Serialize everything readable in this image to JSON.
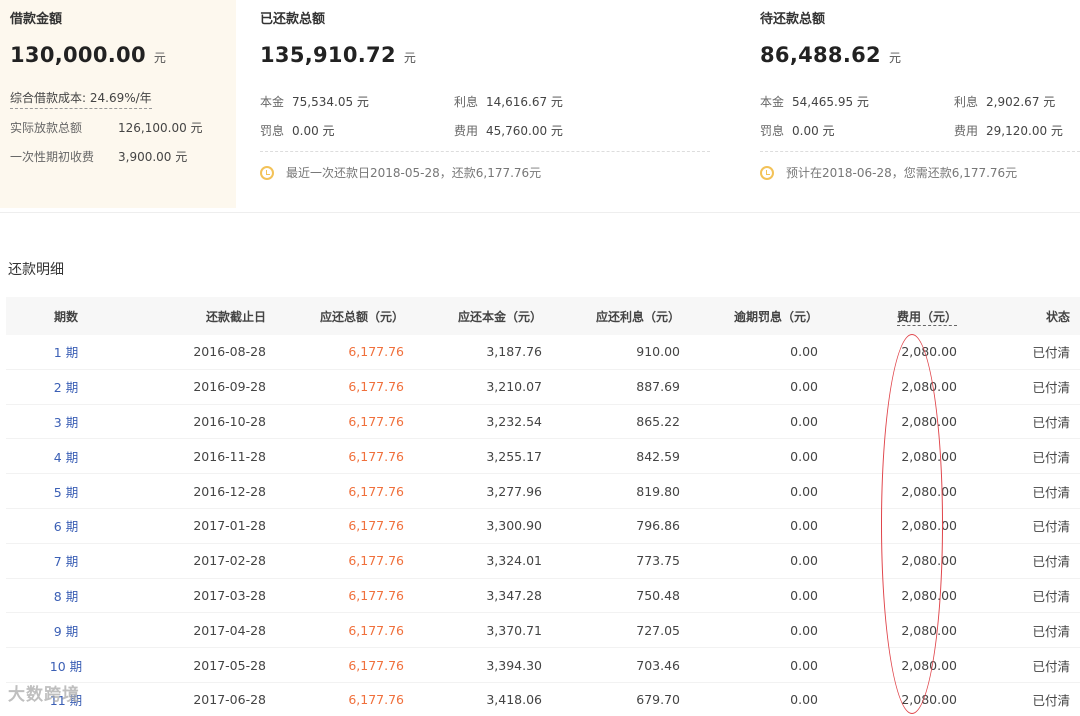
{
  "loan": {
    "title": "借款金額",
    "amount": "130,000.00",
    "unit": "元",
    "cost_rate": "综合借款成本: 24.69%/年",
    "rows": [
      {
        "label": "实际放款总额",
        "value": "126,100.00 元"
      },
      {
        "label": "一次性期初收费",
        "value": "3,900.00 元"
      }
    ]
  },
  "paid": {
    "title": "已还款总额",
    "amount": "135,910.72",
    "unit": "元",
    "items": [
      {
        "label": "本金",
        "value": "75,534.05 元"
      },
      {
        "label": "利息",
        "value": "14,616.67 元"
      },
      {
        "label": "罚息",
        "value": "0.00 元"
      },
      {
        "label": "费用",
        "value": "45,760.00 元"
      }
    ],
    "note": "最近一次还款日2018-05-28，还款6,177.76元"
  },
  "due": {
    "title": "待还款总额",
    "amount": "86,488.62",
    "unit": "元",
    "items": [
      {
        "label": "本金",
        "value": "54,465.95 元"
      },
      {
        "label": "利息",
        "value": "2,902.67 元"
      },
      {
        "label": "罚息",
        "value": "0.00 元"
      },
      {
        "label": "费用",
        "value": "29,120.00 元"
      }
    ],
    "note": "预计在2018-06-28，您需还款6,177.76元"
  },
  "details": {
    "title": "还款明细",
    "headers": [
      "期数",
      "还款截止日",
      "应还总额（元）",
      "应还本金（元）",
      "应还利息（元）",
      "逾期罚息（元）",
      "费用（元）",
      "状态"
    ],
    "rows": [
      [
        "1 期",
        "2016-08-28",
        "6,177.76",
        "3,187.76",
        "910.00",
        "0.00",
        "2,080.00",
        "已付清"
      ],
      [
        "2 期",
        "2016-09-28",
        "6,177.76",
        "3,210.07",
        "887.69",
        "0.00",
        "2,080.00",
        "已付清"
      ],
      [
        "3 期",
        "2016-10-28",
        "6,177.76",
        "3,232.54",
        "865.22",
        "0.00",
        "2,080.00",
        "已付清"
      ],
      [
        "4 期",
        "2016-11-28",
        "6,177.76",
        "3,255.17",
        "842.59",
        "0.00",
        "2,080.00",
        "已付清"
      ],
      [
        "5 期",
        "2016-12-28",
        "6,177.76",
        "3,277.96",
        "819.80",
        "0.00",
        "2,080.00",
        "已付清"
      ],
      [
        "6 期",
        "2017-01-28",
        "6,177.76",
        "3,300.90",
        "796.86",
        "0.00",
        "2,080.00",
        "已付清"
      ],
      [
        "7 期",
        "2017-02-28",
        "6,177.76",
        "3,324.01",
        "773.75",
        "0.00",
        "2,080.00",
        "已付清"
      ],
      [
        "8 期",
        "2017-03-28",
        "6,177.76",
        "3,347.28",
        "750.48",
        "0.00",
        "2,080.00",
        "已付清"
      ],
      [
        "9 期",
        "2017-04-28",
        "6,177.76",
        "3,370.71",
        "727.05",
        "0.00",
        "2,080.00",
        "已付清"
      ],
      [
        "10 期",
        "2017-05-28",
        "6,177.76",
        "3,394.30",
        "703.46",
        "0.00",
        "2,080.00",
        "已付清"
      ],
      [
        "11 期",
        "2017-06-28",
        "6,177.76",
        "3,418.06",
        "679.70",
        "0.00",
        "2,080.00",
        "已付清"
      ]
    ]
  },
  "watermark": "大数跨境",
  "colors": {
    "accent_orange": "#f0703c",
    "link_blue": "#3b5fb5",
    "annotation_red": "#e0444a",
    "loan_bg": "#fdf8ee"
  }
}
